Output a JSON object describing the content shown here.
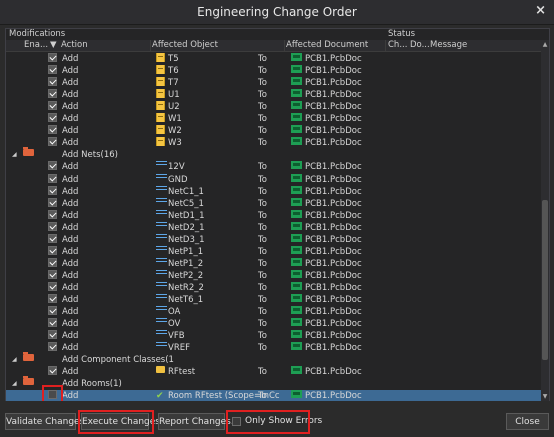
{
  "window": {
    "title": "Engineering Change Order",
    "close_glyph": "×"
  },
  "grid": {
    "group_modifications": "Modifications",
    "group_status": "Status",
    "columns": {
      "enable": "Ena...",
      "action": "Action",
      "affected_object": "Affected Object",
      "affected_document": "Affected Document",
      "check": "Ch...",
      "done": "Do...",
      "message": "Message"
    },
    "rows": [
      {
        "type": "item",
        "checked": true,
        "action": "Add",
        "icon": "component-icon",
        "object": "T5",
        "to": "To",
        "doc": "PCB1.PcbDoc"
      },
      {
        "type": "item",
        "checked": true,
        "action": "Add",
        "icon": "component-icon",
        "object": "T6",
        "to": "To",
        "doc": "PCB1.PcbDoc"
      },
      {
        "type": "item",
        "checked": true,
        "action": "Add",
        "icon": "component-icon",
        "object": "T7",
        "to": "To",
        "doc": "PCB1.PcbDoc"
      },
      {
        "type": "item",
        "checked": true,
        "action": "Add",
        "icon": "component-icon",
        "object": "U1",
        "to": "To",
        "doc": "PCB1.PcbDoc"
      },
      {
        "type": "item",
        "checked": true,
        "action": "Add",
        "icon": "component-icon",
        "object": "U2",
        "to": "To",
        "doc": "PCB1.PcbDoc"
      },
      {
        "type": "item",
        "checked": true,
        "action": "Add",
        "icon": "component-icon",
        "object": "W1",
        "to": "To",
        "doc": "PCB1.PcbDoc"
      },
      {
        "type": "item",
        "checked": true,
        "action": "Add",
        "icon": "component-icon",
        "object": "W2",
        "to": "To",
        "doc": "PCB1.PcbDoc"
      },
      {
        "type": "item",
        "checked": true,
        "action": "Add",
        "icon": "component-icon",
        "object": "W3",
        "to": "To",
        "doc": "PCB1.PcbDoc"
      },
      {
        "type": "group",
        "label": "Add Nets(16)"
      },
      {
        "type": "item",
        "checked": true,
        "action": "Add",
        "icon": "net-icon",
        "object": "12V",
        "to": "To",
        "doc": "PCB1.PcbDoc"
      },
      {
        "type": "item",
        "checked": true,
        "action": "Add",
        "icon": "net-icon",
        "object": "GND",
        "to": "To",
        "doc": "PCB1.PcbDoc"
      },
      {
        "type": "item",
        "checked": true,
        "action": "Add",
        "icon": "net-icon",
        "object": "NetC1_1",
        "to": "To",
        "doc": "PCB1.PcbDoc"
      },
      {
        "type": "item",
        "checked": true,
        "action": "Add",
        "icon": "net-icon",
        "object": "NetC5_1",
        "to": "To",
        "doc": "PCB1.PcbDoc"
      },
      {
        "type": "item",
        "checked": true,
        "action": "Add",
        "icon": "net-icon",
        "object": "NetD1_1",
        "to": "To",
        "doc": "PCB1.PcbDoc"
      },
      {
        "type": "item",
        "checked": true,
        "action": "Add",
        "icon": "net-icon",
        "object": "NetD2_1",
        "to": "To",
        "doc": "PCB1.PcbDoc"
      },
      {
        "type": "item",
        "checked": true,
        "action": "Add",
        "icon": "net-icon",
        "object": "NetD3_1",
        "to": "To",
        "doc": "PCB1.PcbDoc"
      },
      {
        "type": "item",
        "checked": true,
        "action": "Add",
        "icon": "net-icon",
        "object": "NetP1_1",
        "to": "To",
        "doc": "PCB1.PcbDoc"
      },
      {
        "type": "item",
        "checked": true,
        "action": "Add",
        "icon": "net-icon",
        "object": "NetP1_2",
        "to": "To",
        "doc": "PCB1.PcbDoc"
      },
      {
        "type": "item",
        "checked": true,
        "action": "Add",
        "icon": "net-icon",
        "object": "NetP2_2",
        "to": "To",
        "doc": "PCB1.PcbDoc"
      },
      {
        "type": "item",
        "checked": true,
        "action": "Add",
        "icon": "net-icon",
        "object": "NetR2_2",
        "to": "To",
        "doc": "PCB1.PcbDoc"
      },
      {
        "type": "item",
        "checked": true,
        "action": "Add",
        "icon": "net-icon",
        "object": "NetT6_1",
        "to": "To",
        "doc": "PCB1.PcbDoc"
      },
      {
        "type": "item",
        "checked": true,
        "action": "Add",
        "icon": "net-icon",
        "object": "OA",
        "to": "To",
        "doc": "PCB1.PcbDoc"
      },
      {
        "type": "item",
        "checked": true,
        "action": "Add",
        "icon": "net-icon",
        "object": "OV",
        "to": "To",
        "doc": "PCB1.PcbDoc"
      },
      {
        "type": "item",
        "checked": true,
        "action": "Add",
        "icon": "net-icon",
        "object": "VFB",
        "to": "To",
        "doc": "PCB1.PcbDoc"
      },
      {
        "type": "item",
        "checked": true,
        "action": "Add",
        "icon": "net-icon",
        "object": "VREF",
        "to": "To",
        "doc": "PCB1.PcbDoc"
      },
      {
        "type": "group",
        "label": "Add Component Classes(1"
      },
      {
        "type": "item",
        "checked": true,
        "action": "Add",
        "icon": "class-icon",
        "object": "RFtest",
        "to": "To",
        "doc": "PCB1.PcbDoc"
      },
      {
        "type": "group",
        "label": "Add Rooms(1)"
      },
      {
        "type": "item",
        "checked": false,
        "selected": true,
        "action": "Add",
        "icon": "room-icon",
        "object": "Room RFtest (Scope=InCc",
        "to": "To",
        "doc": "PCB1.PcbDoc"
      }
    ]
  },
  "buttons": {
    "validate": "Validate Changes",
    "execute": "Execute Changes",
    "report": "Report Changes...",
    "only_errors": "Only Show Errors",
    "close": "Close"
  },
  "colors": {
    "highlight": "#e02020",
    "selection": "#3d6a94"
  }
}
